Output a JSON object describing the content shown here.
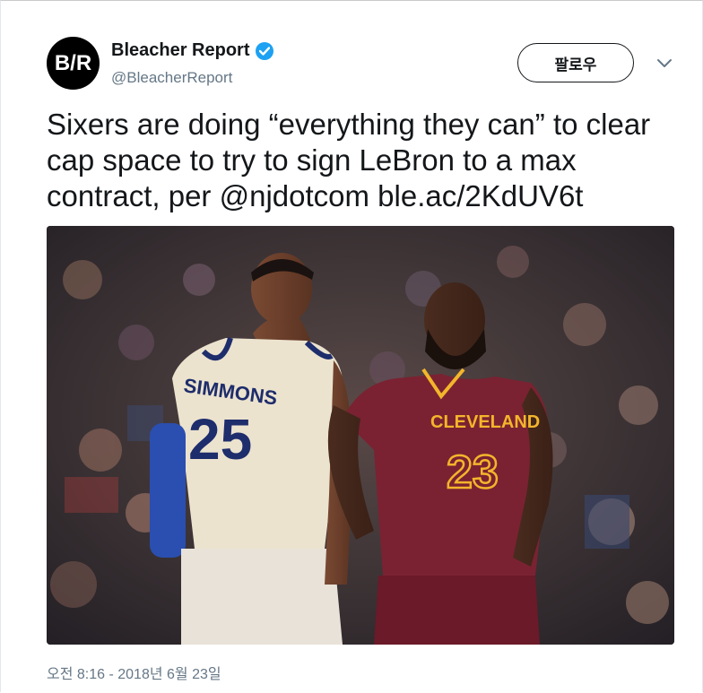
{
  "tweet": {
    "avatar_text": "B/R",
    "display_name": "Bleacher Report",
    "handle": "@BleacherReport",
    "follow_label": "팔로우",
    "text_lines": [
      "Sixers are doing “everything they can” to clear",
      "cap space to try to sign LeBron to a max",
      "contract, per @njdotcom ble.ac/2KdUV6t"
    ],
    "timestamp": "오전 8:16 - 2018년 6월 23일"
  },
  "photo": {
    "left_jersey": {
      "name": "SIMMONS",
      "number": "25"
    },
    "right_jersey": {
      "team": "CLEVELAND",
      "number": "23"
    }
  },
  "colors": {
    "verified_blue": "#1da1f2",
    "muted_text": "#657786",
    "sixers_cream": "#ece3cf",
    "sixers_navy": "#1e2d6b",
    "cavs_wine": "#7a2232",
    "cavs_gold": "#f3b52b"
  },
  "icons": {
    "verified": "verified-badge-icon",
    "more": "chevron-down-icon"
  }
}
